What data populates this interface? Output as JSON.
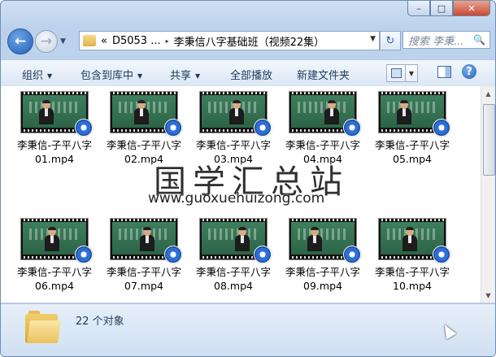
{
  "window": {
    "min_glyph": "–",
    "max_glyph": "□",
    "close_glyph": "✕"
  },
  "nav": {
    "back_icon": "back-arrow-icon",
    "back_glyph": "←",
    "forward_icon": "forward-arrow-icon",
    "forward_glyph": "→",
    "dropdown_glyph": "▼"
  },
  "address": {
    "chevrons": "«",
    "crumb_parent": "D5053 ...",
    "sep": "▸",
    "crumb_current": "李秉信八字基础班（视频22集）",
    "dropdown_glyph": "▼",
    "refresh_glyph": "↻"
  },
  "search": {
    "placeholder": "搜索 李秉...",
    "icon_glyph": "🔍"
  },
  "toolbar": {
    "organize": "组织",
    "include_library": "包含到库中",
    "share": "共享",
    "play_all": "全部播放",
    "new_folder": "新建文件夹",
    "caret": "▼",
    "help_glyph": "?"
  },
  "files": [
    {
      "line1": "李秉信-子平八字",
      "line2": "01.mp4"
    },
    {
      "line1": "李秉信-子平八字",
      "line2": "02.mp4"
    },
    {
      "line1": "李秉信-子平八字",
      "line2": "03.mp4"
    },
    {
      "line1": "李秉信-子平八字",
      "line2": "04.mp4"
    },
    {
      "line1": "李秉信-子平八字",
      "line2": "05.mp4"
    },
    {
      "line1": "李秉信-子平八字",
      "line2": "06.mp4"
    },
    {
      "line1": "李秉信-子平八字",
      "line2": "07.mp4"
    },
    {
      "line1": "李秉信-子平八字",
      "line2": "08.mp4"
    },
    {
      "line1": "李秉信-子平八字",
      "line2": "09.mp4"
    },
    {
      "line1": "李秉信-子平八字",
      "line2": "10.mp4"
    }
  ],
  "watermark": {
    "cn": "国学汇总站",
    "url": "www.guoxuehuizong.com"
  },
  "status": {
    "count": "22 个对象"
  },
  "scrollbar": {
    "up": "▲",
    "down": "▼"
  },
  "colors": {
    "chrome": "#bcd2ec",
    "toolbar_text": "#1e395b",
    "badge": "#2c6fd6",
    "chalkboard": "#2c6447"
  }
}
